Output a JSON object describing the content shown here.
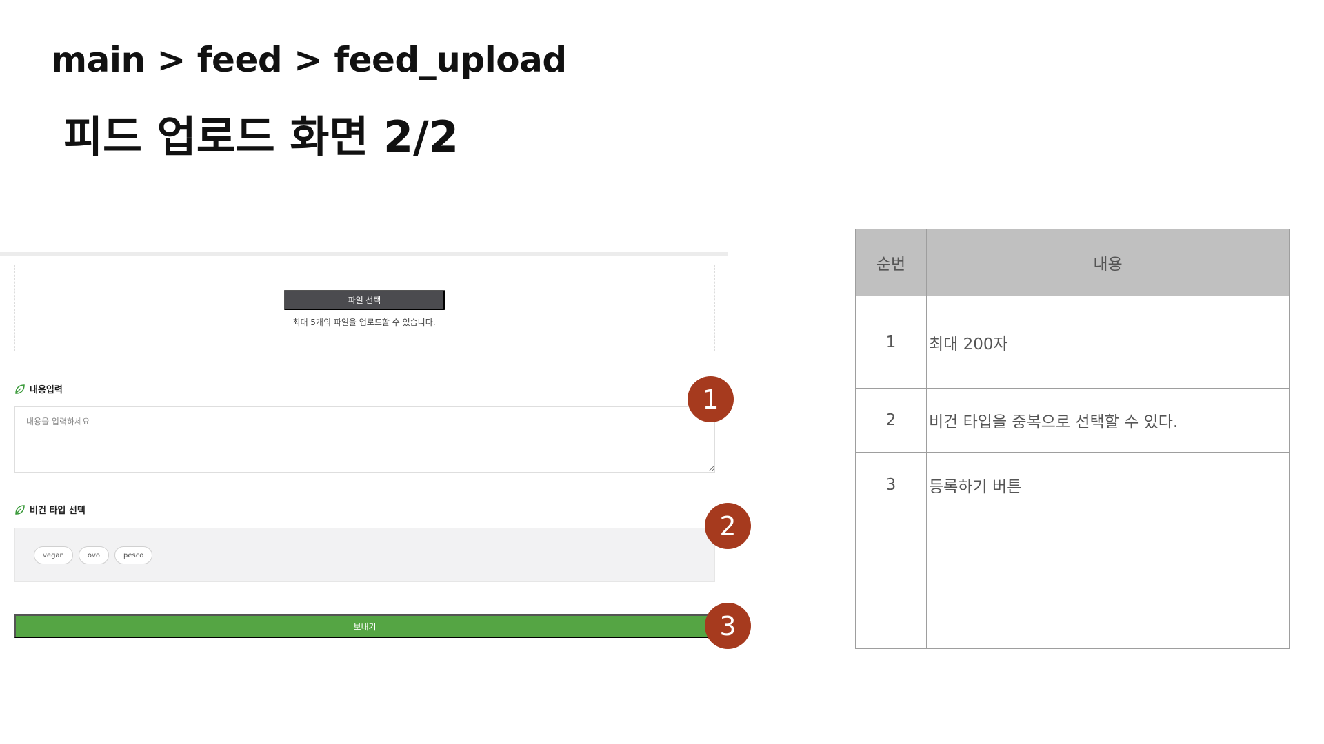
{
  "header": {
    "breadcrumb": "main > feed > feed_upload",
    "title": "피드 업로드 화면 2/2"
  },
  "form": {
    "file_button": "파일 선택",
    "upload_hint": "최대 5개의 파일을 업로드할 수 있습니다.",
    "content_label": "내용입력",
    "content_placeholder": "내용을 입력하세요",
    "vegan_label": "비건 타입 선택",
    "tags": [
      "vegan",
      "ovo",
      "pesco"
    ],
    "submit": "보내기"
  },
  "markers": [
    "1",
    "2",
    "3"
  ],
  "colors": {
    "marker": "#a63a1e",
    "submit": "#55a544",
    "file_button": "#4b4b4f",
    "leaf": "#3a9a3a",
    "table_header": "#c0c0c0"
  },
  "icons": [
    "leaf-icon",
    "resize-handle-icon"
  ],
  "spec": {
    "headers": [
      "순번",
      "내용"
    ],
    "rows": [
      {
        "no": "1",
        "desc": "최대 200자"
      },
      {
        "no": "2",
        "desc": "비건 타입을 중복으로 선택할 수 있다."
      },
      {
        "no": "3",
        "desc": "등록하기 버튼"
      },
      {
        "no": "",
        "desc": ""
      },
      {
        "no": "",
        "desc": ""
      }
    ]
  }
}
